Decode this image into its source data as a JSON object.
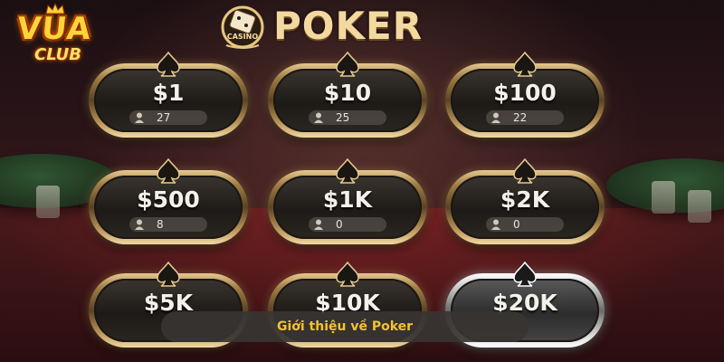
{
  "brand": {
    "logo_top": "VUA",
    "logo_bottom": "CLUB"
  },
  "header": {
    "casino_badge": "CASINO",
    "title": "POKER"
  },
  "rooms": [
    {
      "amount": "$1",
      "players": "27",
      "style": "gold"
    },
    {
      "amount": "$10",
      "players": "25",
      "style": "gold"
    },
    {
      "amount": "$100",
      "players": "22",
      "style": "gold"
    },
    {
      "amount": "$500",
      "players": "8",
      "style": "gold"
    },
    {
      "amount": "$1K",
      "players": "0",
      "style": "gold"
    },
    {
      "amount": "$2K",
      "players": "0",
      "style": "gold"
    },
    {
      "amount": "$5K",
      "players": "",
      "style": "gold"
    },
    {
      "amount": "$10K",
      "players": "",
      "style": "gold"
    },
    {
      "amount": "$20K",
      "players": "",
      "style": "silver"
    }
  ],
  "caption": "Giới thiệu về Poker",
  "colors": {
    "gold_text": "#f3d9a0",
    "caption_text": "#f3c232",
    "logo_yellow": "#ffd43a"
  },
  "icons": {
    "room_top": "spade-icon",
    "players": "user-icon"
  }
}
